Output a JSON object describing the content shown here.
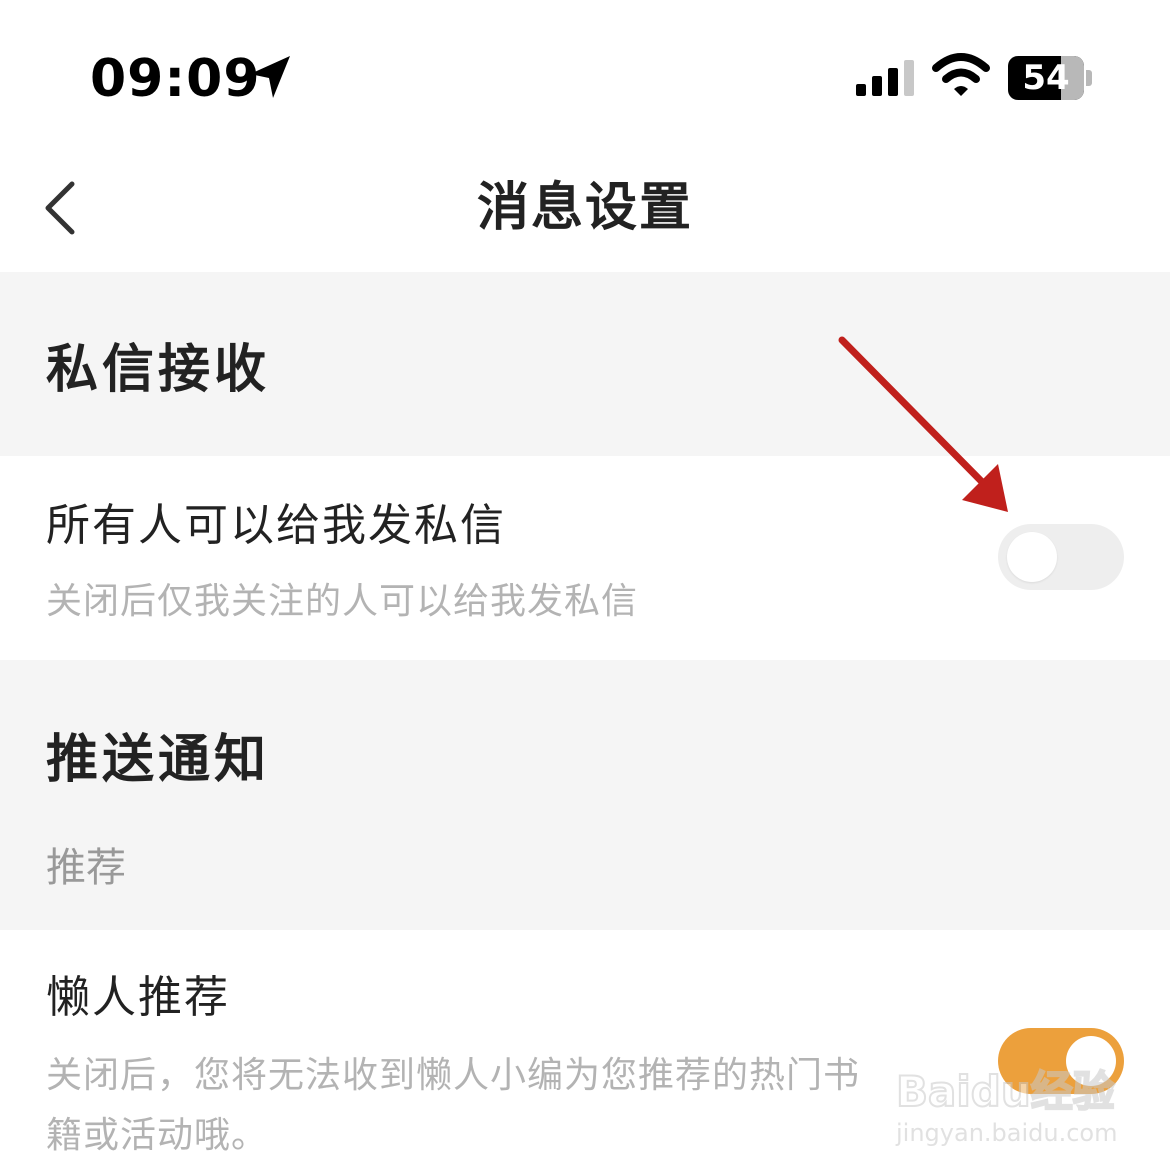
{
  "status_bar": {
    "time": "09:09",
    "battery_level": "54",
    "icons": [
      "location-arrow-icon",
      "cellular-signal-icon",
      "wifi-icon",
      "battery-icon"
    ]
  },
  "nav": {
    "title": "消息设置",
    "back_icon": "chevron-left-icon"
  },
  "sections": {
    "private_message": {
      "header": "私信接收",
      "items": [
        {
          "title": "所有人可以给我发私信",
          "description": "关闭后仅我关注的人可以给我发私信",
          "enabled": false
        }
      ]
    },
    "push": {
      "header": "推送通知",
      "subheader": "推荐",
      "items": [
        {
          "title": "懒人推荐",
          "description_line1": "关闭后，您将无法收到懒人小编为您推荐的热门书",
          "description_line2": "籍或活动哦。",
          "enabled": true
        }
      ]
    }
  },
  "annotation": {
    "type": "red-arrow-icon",
    "color": "#c0201c"
  },
  "watermark": {
    "brand": "Baidu经验",
    "url": "jingyan.baidu.com"
  },
  "colors": {
    "accent": "#eca03c",
    "section_bg": "#f5f5f5",
    "toggle_off": "#eeeeee",
    "secondary_text": "#b3b3b3"
  }
}
